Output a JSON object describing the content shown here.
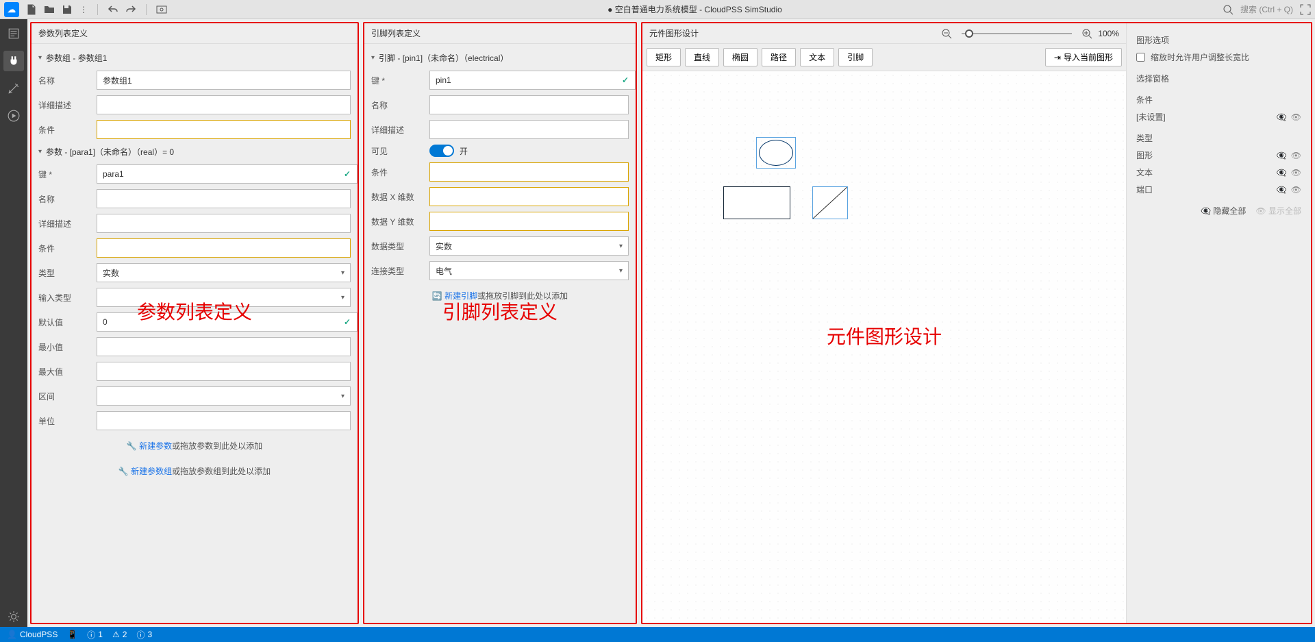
{
  "toolbar": {
    "title": "● 空白普通电力系统模型 - CloudPSS SimStudio",
    "search_placeholder": "搜索 (Ctrl + Q)"
  },
  "panels": {
    "params": {
      "title": "参数列表定义",
      "big_label": "参数列表定义",
      "group_header": "参数组 - 参数组1",
      "fields": {
        "name_label": "名称",
        "name_value": "参数组1",
        "desc_label": "详细描述",
        "cond_label": "条件"
      },
      "param_header": "参数 - [para1]（未命名）（real）= 0",
      "pfields": {
        "key_label": "键 *",
        "key_value": "para1",
        "name_label": "名称",
        "desc_label": "详细描述",
        "cond_label": "条件",
        "type_label": "类型",
        "type_value": "实数",
        "input_type_label": "输入类型",
        "default_label": "默认值",
        "default_value": "0",
        "min_label": "最小值",
        "max_label": "最大值",
        "interval_label": "区间",
        "unit_label": "单位"
      },
      "new_param_link": "新建参数",
      "new_param_tail": "或拖放参数到此处以添加",
      "new_group_link": "新建参数组",
      "new_group_tail": "或拖放参数组到此处以添加"
    },
    "pins": {
      "title": "引脚列表定义",
      "big_label": "引脚列表定义",
      "pin_header": "引脚 - [pin1]（未命名）（electrical）",
      "fields": {
        "key_label": "键 *",
        "key_value": "pin1",
        "name_label": "名称",
        "desc_label": "详细描述",
        "visible_label": "可见",
        "visible_text": "开",
        "cond_label": "条件",
        "datax_label": "数据 X 维数",
        "datay_label": "数据 Y 维数",
        "dtype_label": "数据类型",
        "dtype_value": "实数",
        "ctype_label": "连接类型",
        "ctype_value": "电气"
      },
      "new_pin_link": "新建引脚",
      "new_pin_tail": "或拖放引脚到此处以添加"
    },
    "graphic": {
      "title": "元件图形设计",
      "big_label": "元件图形设计",
      "tools": {
        "rect": "矩形",
        "line": "直线",
        "ellipse": "椭圆",
        "path": "路径",
        "text": "文本",
        "pin": "引脚",
        "import": "导入当前图形"
      },
      "zoom": "100%",
      "side": {
        "opts_title": "图形选项",
        "scale_allow": "缩放时允许用户调整长宽比",
        "select_title": "选择窗格",
        "cond_title": "条件",
        "cond_value": "[未设置]",
        "type_title": "类型",
        "type_items": {
          "shape": "图形",
          "text": "文本",
          "port": "端口"
        },
        "hide_all": "隐藏全部",
        "show_all": "显示全部"
      }
    }
  },
  "status": {
    "user": "CloudPSS",
    "info": "1",
    "warn": "2",
    "extra": "3"
  }
}
